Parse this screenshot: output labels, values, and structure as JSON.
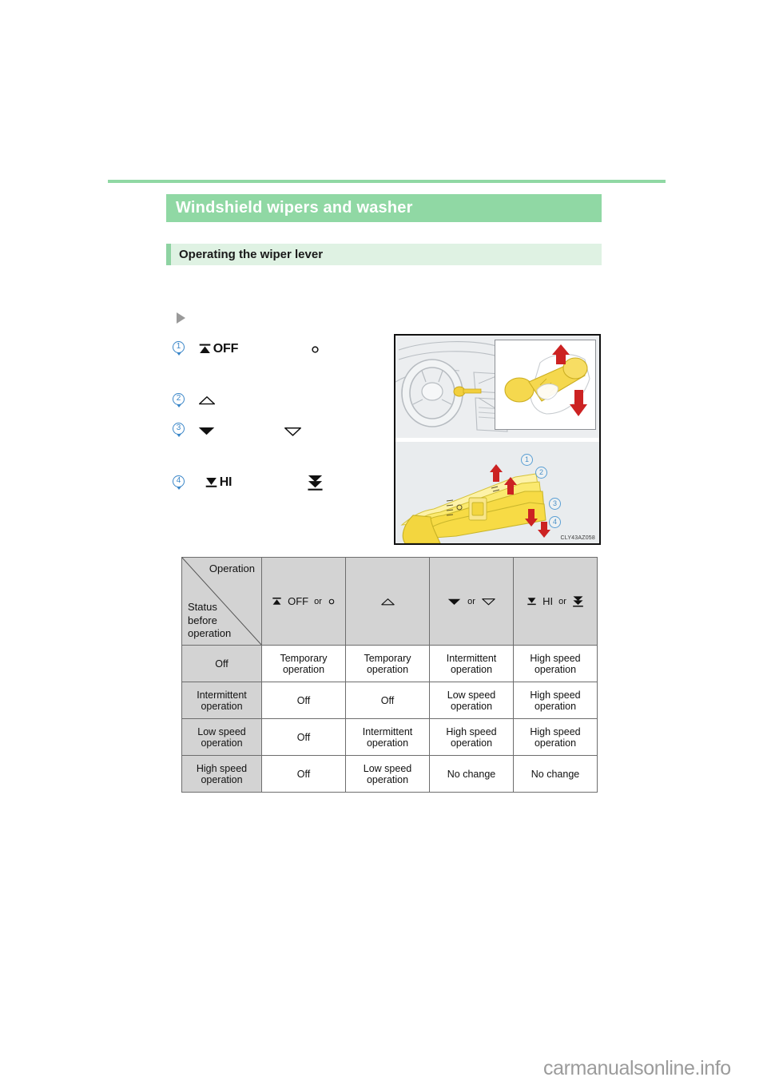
{
  "page": {
    "section_title": "Windshield wipers and washer",
    "subsection_title": "Operating the wiper lever",
    "watermark": "carmanualsonline.info",
    "accent_green": "#90d8a4",
    "accent_green_light": "#dff2e3",
    "accent_blue": "#3a86c8"
  },
  "lever_positions": [
    {
      "number": "1",
      "icon_label": "OFF",
      "icon_name": "wiper-off-icon",
      "alt_icon_name": "mist-circle-icon",
      "alt_icon_label": "o"
    },
    {
      "number": "2",
      "icon_label": "",
      "icon_name": "triangle-up-outline-icon",
      "alt_icon_name": "",
      "alt_icon_label": ""
    },
    {
      "number": "3",
      "icon_label": "",
      "icon_name": "triangle-down-filled-icon",
      "alt_icon_name": "triangle-down-outline-icon",
      "alt_icon_label": ""
    },
    {
      "number": "4",
      "icon_label": "HI",
      "icon_name": "wiper-hi-icon",
      "alt_icon_name": "double-chevron-down-icon",
      "alt_icon_label": ""
    }
  ],
  "illustration": {
    "code": "CLY43AZ058",
    "callouts": [
      "1",
      "2",
      "3",
      "4"
    ]
  },
  "table": {
    "corner": {
      "operation_label": "Operation",
      "status_label": "Status\nbefore\noperation",
      "status_line1": "Status",
      "status_line2": "before",
      "status_line3": "operation"
    },
    "or_word": "or",
    "columns": [
      {
        "primary_label": "OFF",
        "primary_icon": "wiper-off-icon",
        "has_or": true,
        "secondary_label": "o",
        "secondary_icon": "mist-circle-icon"
      },
      {
        "primary_label": "",
        "primary_icon": "triangle-up-outline-icon",
        "has_or": false,
        "secondary_label": "",
        "secondary_icon": ""
      },
      {
        "primary_label": "",
        "primary_icon": "triangle-down-filled-icon",
        "has_or": true,
        "secondary_label": "",
        "secondary_icon": "triangle-down-outline-icon"
      },
      {
        "primary_label": "HI",
        "primary_icon": "wiper-hi-icon",
        "has_or": true,
        "secondary_label": "",
        "secondary_icon": "double-chevron-down-icon"
      }
    ],
    "rows": [
      {
        "status": "Off",
        "cells": [
          "Temporary operation",
          "Temporary operation",
          "Intermittent operation",
          "High speed operation"
        ]
      },
      {
        "status": "Intermittent operation",
        "cells": [
          "Off",
          "Off",
          "Low speed operation",
          "High speed operation"
        ]
      },
      {
        "status": "Low speed operation",
        "cells": [
          "Off",
          "Intermittent operation",
          "High speed operation",
          "High speed operation"
        ]
      },
      {
        "status": "High speed operation",
        "cells": [
          "Off",
          "Low speed operation",
          "No change",
          "No change"
        ]
      }
    ]
  }
}
